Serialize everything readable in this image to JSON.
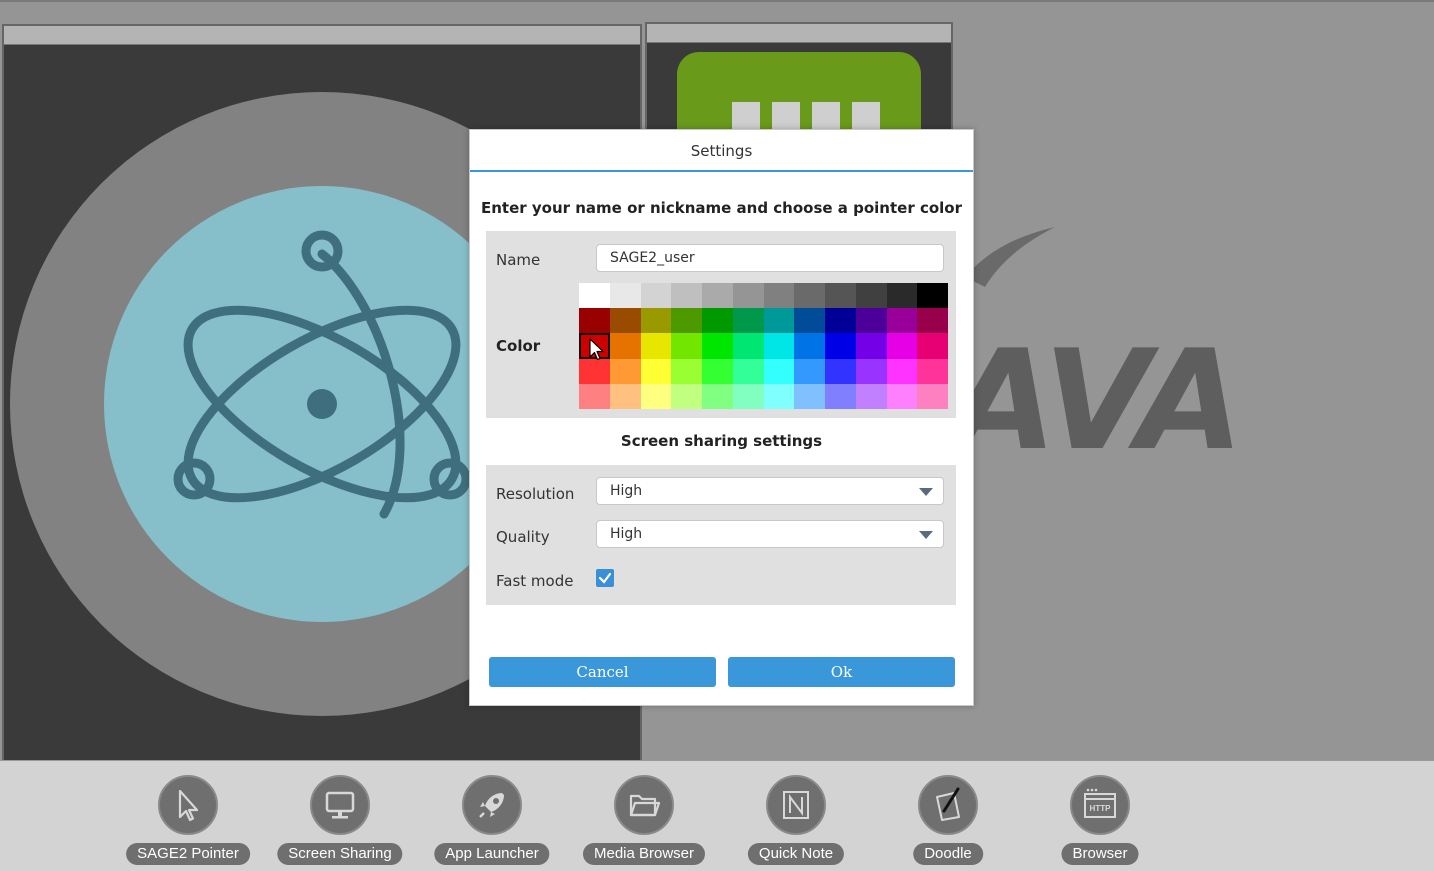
{
  "dialog": {
    "title": "Settings",
    "heading": "Enter your name or nickname and choose a pointer color",
    "name_label": "Name",
    "name_value": "SAGE2_user",
    "color_label": "Color",
    "share_heading": "Screen sharing settings",
    "resolution_label": "Resolution",
    "resolution_value": "High",
    "quality_label": "Quality",
    "quality_value": "High",
    "fastmode_label": "Fast mode",
    "fastmode_checked": true,
    "cancel_label": "Cancel",
    "ok_label": "Ok",
    "accent_color": "#3a97d9",
    "selected_color_index": 24,
    "palette": [
      "#ffffff",
      "#e8e8e8",
      "#d3d3d3",
      "#bfbfbf",
      "#aaaaaa",
      "#959595",
      "#808080",
      "#6a6a6a",
      "#555555",
      "#404040",
      "#2a2a2a",
      "#000000",
      "#990000",
      "#994c00",
      "#999900",
      "#4c9900",
      "#009900",
      "#00994c",
      "#009999",
      "#004c99",
      "#000099",
      "#4c0099",
      "#990099",
      "#99004c",
      "#cc0000",
      "#e67300",
      "#e6e600",
      "#73e600",
      "#00e600",
      "#00e673",
      "#00e6e6",
      "#0073e6",
      "#0000e6",
      "#7300e6",
      "#e600e6",
      "#e60073",
      "#ff3333",
      "#ff9933",
      "#ffff33",
      "#99ff33",
      "#33ff33",
      "#33ff99",
      "#33ffff",
      "#3399ff",
      "#3333ff",
      "#9933ff",
      "#ff33ff",
      "#ff3399",
      "#ff8080",
      "#ffc080",
      "#ffff80",
      "#c0ff80",
      "#80ff80",
      "#80ffc0",
      "#80ffff",
      "#80c0ff",
      "#8080ff",
      "#c080ff",
      "#ff80ff",
      "#ff80c0"
    ]
  },
  "background": {
    "java_text": "AVA"
  },
  "taskbar": {
    "items": [
      {
        "label": "SAGE2 Pointer",
        "icon": "pointer-icon"
      },
      {
        "label": "Screen Sharing",
        "icon": "monitor-icon"
      },
      {
        "label": "App Launcher",
        "icon": "rocket-icon"
      },
      {
        "label": "Media Browser",
        "icon": "folder-icon"
      },
      {
        "label": "Quick Note",
        "icon": "note-icon"
      },
      {
        "label": "Doodle",
        "icon": "pen-icon"
      },
      {
        "label": "Browser",
        "icon": "http-browser-icon"
      }
    ]
  }
}
